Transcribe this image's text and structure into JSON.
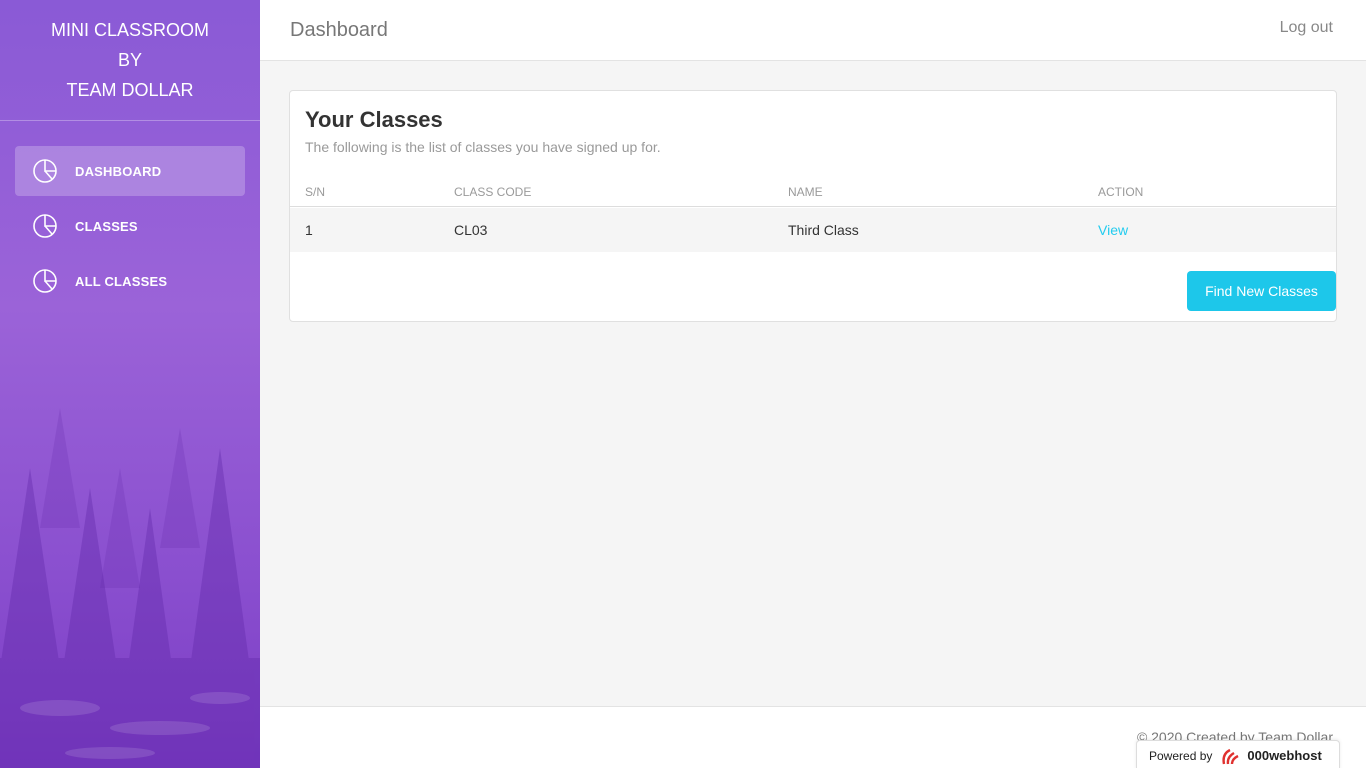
{
  "brand": {
    "line1": "MINI CLASSROOM",
    "line2": "BY",
    "line3": "TEAM DOLLAR"
  },
  "sidebar": {
    "items": [
      {
        "label": "DASHBOARD",
        "icon": "pie-chart-icon",
        "active": true
      },
      {
        "label": "CLASSES",
        "icon": "pie-chart-icon",
        "active": false
      },
      {
        "label": "ALL CLASSES",
        "icon": "pie-chart-icon",
        "active": false
      }
    ]
  },
  "header": {
    "title": "Dashboard",
    "logout": "Log out"
  },
  "card": {
    "title": "Your Classes",
    "subtitle": "The following is the list of classes you have signed up for.",
    "columns": [
      "S/N",
      "CLASS CODE",
      "NAME",
      "ACTION"
    ],
    "rows": [
      {
        "sn": "1",
        "code": "CL03",
        "name": "Third Class",
        "action": "View"
      }
    ],
    "button": "Find New Classes"
  },
  "footer": {
    "copyright": "© 2020 Created by Team Dollar",
    "powered_by": "Powered by",
    "host": "000webhost"
  },
  "colors": {
    "accent": "#1dc7ea",
    "link": "#23ccef",
    "sidebar": "#9368e9"
  }
}
